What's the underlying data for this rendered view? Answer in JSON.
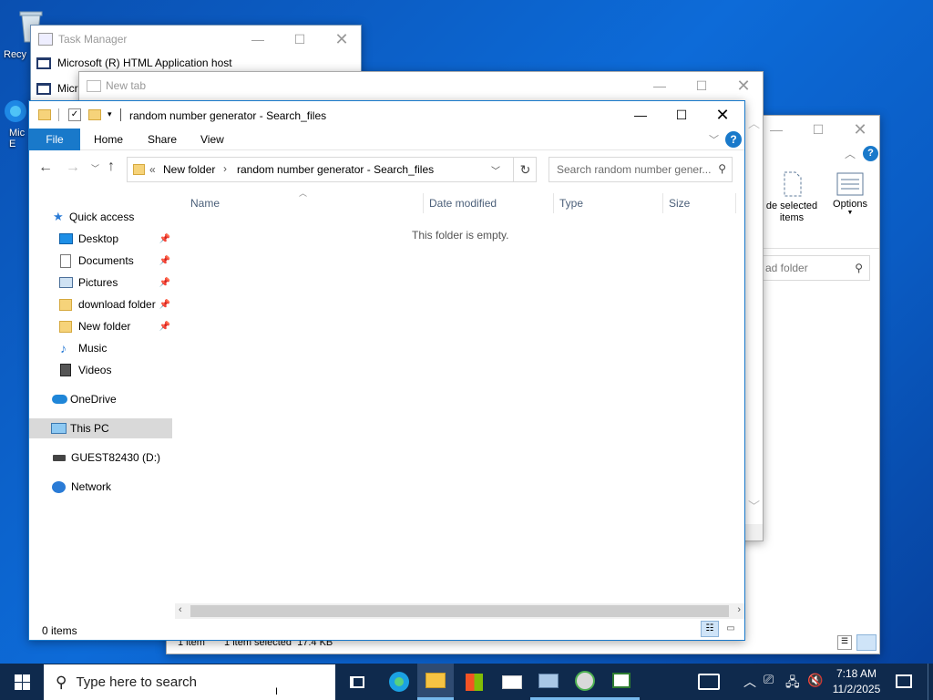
{
  "desktop": {
    "icons": [
      {
        "label": "Recy"
      },
      {
        "label": "Mic\nE"
      }
    ]
  },
  "task_manager": {
    "title": "Task Manager",
    "rows": [
      "Microsoft (R) HTML Application host",
      "Micr"
    ]
  },
  "browser": {
    "title": "New tab"
  },
  "explorer_back": {
    "ribbon": {
      "hide_selected": "de selected\nitems",
      "options": "Options"
    },
    "search_placeholder": "ad folder",
    "status": {
      "items": "1 item",
      "selected": "1 item selected  17.4 KB"
    }
  },
  "explorer": {
    "title": "random number generator - Search_files",
    "menu": {
      "file": "File",
      "home": "Home",
      "share": "Share",
      "view": "View"
    },
    "address": {
      "overflow": "«",
      "crumbs": [
        "New folder",
        "random number generator - Search_files"
      ]
    },
    "search_placeholder": "Search random number gener...",
    "columns": {
      "name": "Name",
      "date_modified": "Date modified",
      "type": "Type",
      "size": "Size"
    },
    "empty_message": "This folder is empty.",
    "nav": {
      "quick_access": "Quick access",
      "items": [
        {
          "label": "Desktop",
          "icon": "desktop-icon",
          "pinned": true
        },
        {
          "label": "Documents",
          "icon": "documents-icon",
          "pinned": true
        },
        {
          "label": "Pictures",
          "icon": "pictures-icon",
          "pinned": true
        },
        {
          "label": "download folder",
          "icon": "folder-icon",
          "pinned": true
        },
        {
          "label": "New folder",
          "icon": "folder-icon",
          "pinned": true
        },
        {
          "label": "Music",
          "icon": "music-icon",
          "pinned": false
        },
        {
          "label": "Videos",
          "icon": "videos-icon",
          "pinned": false
        }
      ],
      "onedrive": "OneDrive",
      "this_pc": "This PC",
      "drive": "GUEST82430 (D:)",
      "network": "Network"
    },
    "status": {
      "items": "0 items"
    }
  },
  "taskbar": {
    "search_placeholder": "Type here to search",
    "clock": {
      "time": "7:18 AM",
      "date": "11/2/2025"
    },
    "apps": [
      "task-view-icon",
      "edge-icon",
      "file-explorer-icon",
      "store-icon",
      "mail-icon",
      "photos-icon",
      "media-icon",
      "app-icon"
    ]
  },
  "colors": {
    "accent": "#1979ca",
    "selected_nav": "#d9d9d9",
    "taskbar": "#0f2a4d"
  }
}
